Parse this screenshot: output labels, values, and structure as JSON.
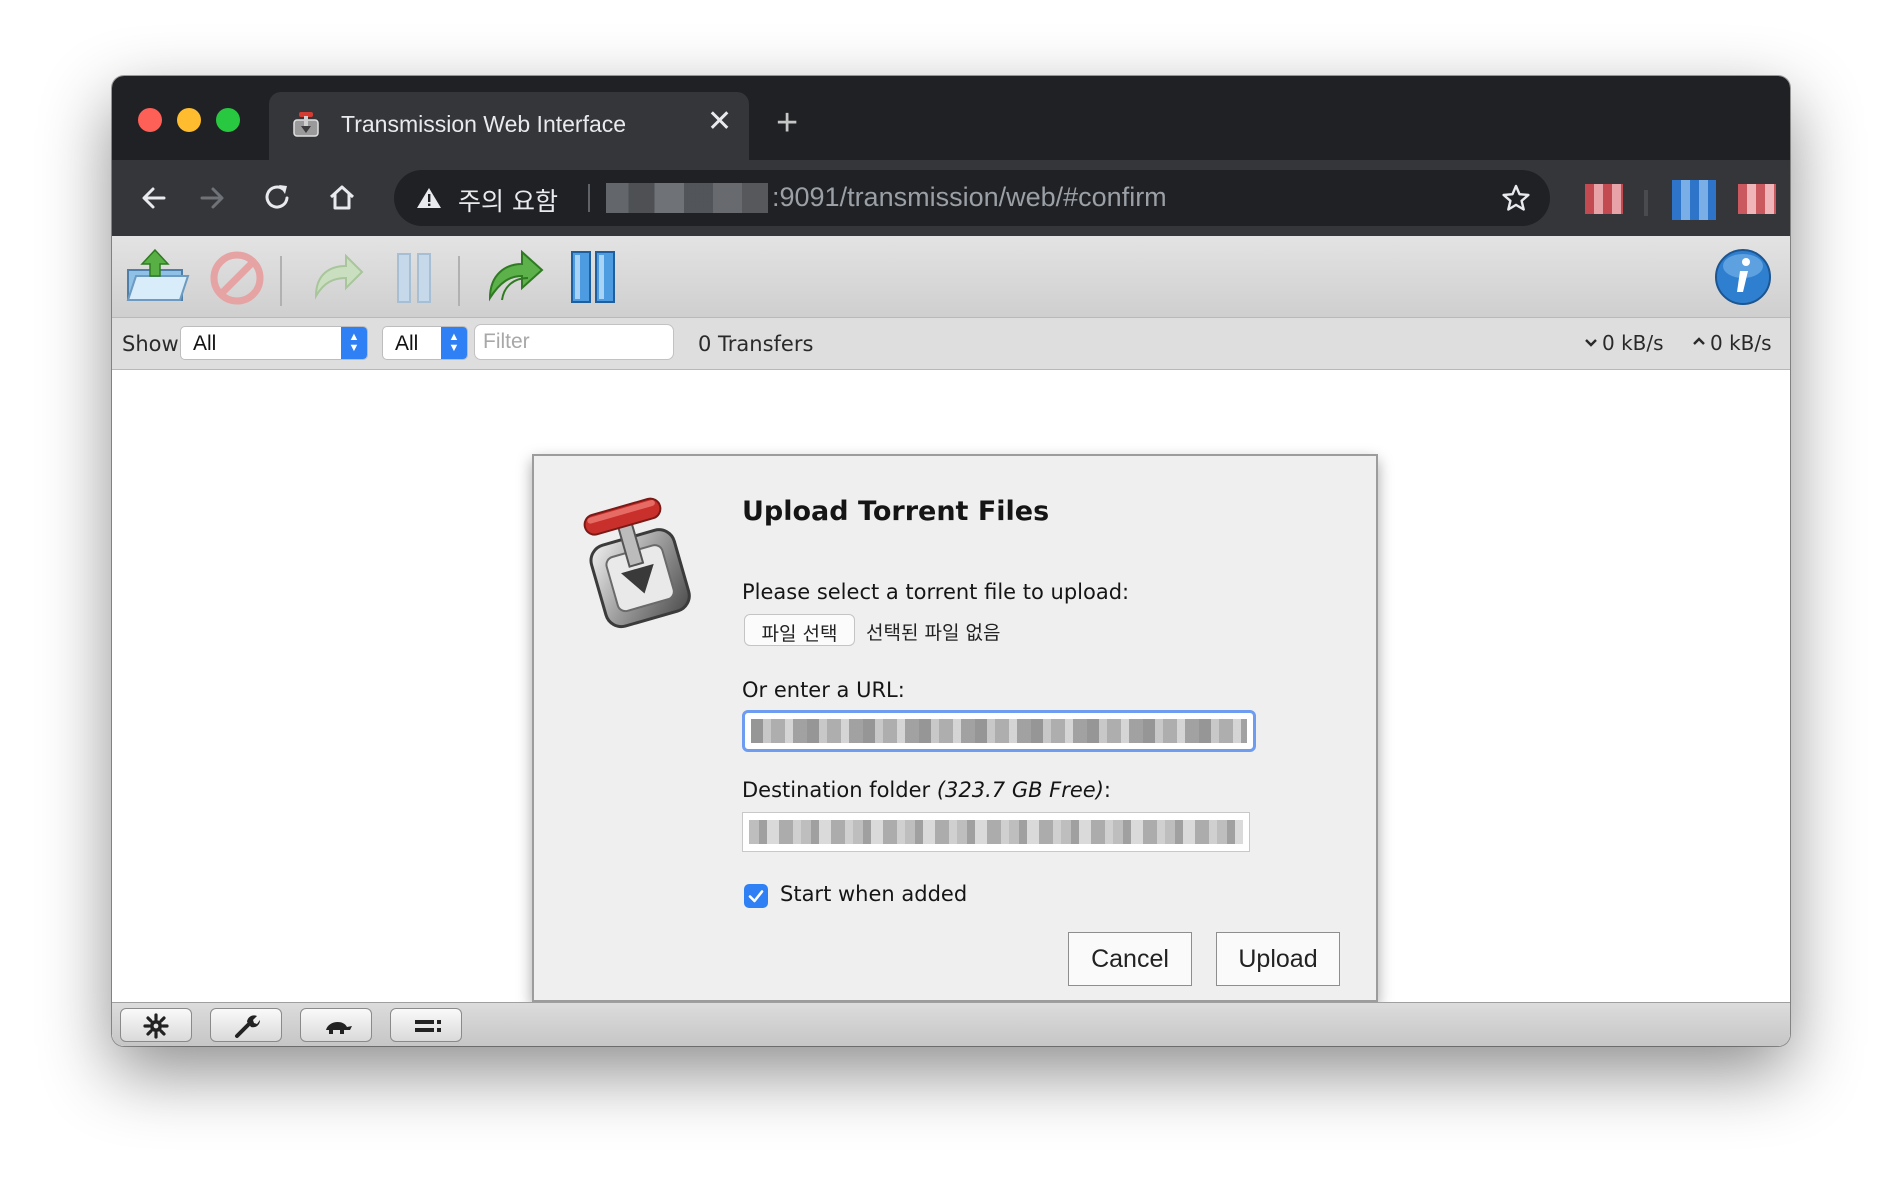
{
  "browser": {
    "tab": {
      "title": "Transmission Web Interface",
      "close_glyph": "✕",
      "favicon": "transmission-favicon"
    },
    "new_tab_glyph": "+",
    "nav": {
      "back_icon": "back-arrow-icon",
      "forward_icon": "forward-arrow-icon",
      "reload_icon": "reload-icon",
      "home_icon": "home-icon"
    },
    "omnibox": {
      "security_label": "주의 요함",
      "url_visible": ":9091/transmission/web/#confirm",
      "bookmark_icon": "star-icon"
    },
    "extensions": [
      "extension-icon-red",
      "extension-icon-blue",
      "extension-icon-pink"
    ]
  },
  "toolbar": {
    "buttons": [
      "open-torrent",
      "remove-torrent",
      "start-torrent",
      "pause-torrent",
      "start-all",
      "pause-all"
    ],
    "inspector": "info-icon"
  },
  "filterbar": {
    "show_label": "Show",
    "status_filter": "All",
    "tracker_filter": "All",
    "filter_placeholder": "Filter",
    "transfers_count": "0 Transfers",
    "download_speed": "0 kB/s",
    "upload_speed": "0 kB/s"
  },
  "dialog": {
    "title": "Upload Torrent Files",
    "select_prompt": "Please select a torrent file to upload:",
    "file_button": "파일 선택",
    "file_none": "선택된 파일 없음",
    "url_label": "Or enter a URL:",
    "destination_label": "Destination folder",
    "free_space": "(323.7 GB Free)",
    "destination_suffix": ":",
    "start_when_added": "Start when added",
    "start_checked": true,
    "cancel": "Cancel",
    "upload": "Upload"
  },
  "statusbar": {
    "buttons": [
      "settings-gear-icon",
      "wrench-icon",
      "turtle-icon",
      "compact-view-icon"
    ]
  },
  "colors": {
    "accent": "#2f7ff5",
    "chrome_dark": "#202124",
    "chrome_tab": "#35363a"
  }
}
